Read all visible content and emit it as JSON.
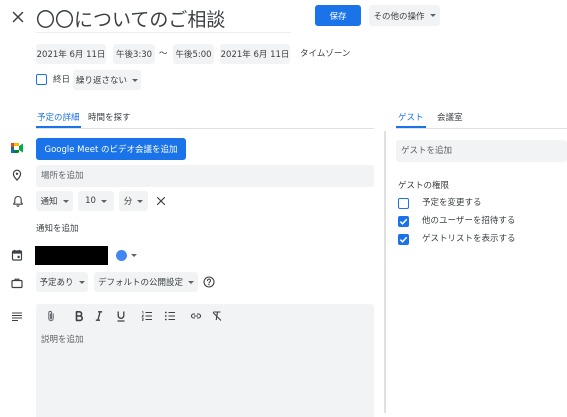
{
  "header": {
    "title": "〇〇についてのご相談",
    "save_label": "保存",
    "more_actions_label": "その他の操作"
  },
  "datetime": {
    "start_date": "2021年 6月 11日",
    "start_time": "午後3:30",
    "separator": "〜",
    "end_time": "午後5:00",
    "end_date": "2021年 6月 11日",
    "timezone_label": "タイムゾーン"
  },
  "recurrence": {
    "all_day_label": "終日",
    "all_day_checked": false,
    "repeat_value": "繰り返さない"
  },
  "left_tabs": [
    {
      "label": "予定の詳細",
      "active": true
    },
    {
      "label": "時間を探す",
      "active": false
    }
  ],
  "event_details": {
    "meet_button_label": "Google Meet のビデオ会議を追加",
    "location_placeholder": "場所を追加",
    "notification": {
      "method": "通知",
      "amount": "10",
      "unit": "分"
    },
    "add_notification_label": "通知を追加",
    "calendar_color": "#4285f4",
    "availability_value": "予定あり",
    "visibility_value": "デフォルトの公開設定",
    "description_placeholder": "説明を追加",
    "description_toolbar": [
      "attach-icon",
      "bold-icon",
      "italic-icon",
      "underline-icon",
      "numbered-list-icon",
      "bulleted-list-icon",
      "link-icon",
      "remove-formatting-icon"
    ]
  },
  "right_tabs": [
    {
      "label": "ゲスト",
      "active": true
    },
    {
      "label": "会議室",
      "active": false
    }
  ],
  "guests": {
    "add_guest_placeholder": "ゲストを追加",
    "permissions_heading": "ゲストの権限",
    "permissions": [
      {
        "label": "予定を変更する",
        "checked": false
      },
      {
        "label": "他のユーザーを招待する",
        "checked": true
      },
      {
        "label": "ゲストリストを表示する",
        "checked": true
      }
    ]
  },
  "icons": {
    "close": "close-icon",
    "meet": "google-meet-icon",
    "location": "location-pin-icon",
    "notification": "bell-icon",
    "remove_notification": "close-icon",
    "calendar": "calendar-icon",
    "availability": "briefcase-icon",
    "visibility_help": "help-icon",
    "description": "description-icon"
  },
  "theme": {
    "accent": "#1a73e8",
    "field_background": "#f1f3f4",
    "text": "#3c4043"
  }
}
